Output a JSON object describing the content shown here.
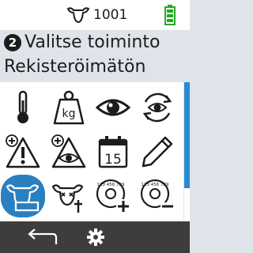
{
  "status_bar": {
    "cow_id": "1001",
    "cow_icon": "cow-head-icon",
    "battery_icon": "battery-full-icon",
    "battery_level": 1.0,
    "battery_color": "#22aa22"
  },
  "header": {
    "step": "2",
    "title": "Valitse toiminto",
    "subtitle": "Rekisteröimätön"
  },
  "actions": [
    {
      "icon": "thermometer-icon",
      "label": ""
    },
    {
      "icon": "weight-kg-icon",
      "label": "kg"
    },
    {
      "icon": "eye-icon",
      "label": ""
    },
    {
      "icon": "eye-repeat-icon",
      "label": ""
    },
    {
      "icon": "warning-plus-icon",
      "label": ""
    },
    {
      "icon": "eye-warning-plus-icon",
      "label": ""
    },
    {
      "icon": "calendar-icon",
      "label": "15"
    },
    {
      "icon": "pencil-icon",
      "label": ""
    },
    {
      "icon": "cow-card-icon",
      "label": ""
    },
    {
      "icon": "cow-death-icon",
      "label": ""
    },
    {
      "icon": "tag-add-icon",
      "label": "123 456 789"
    },
    {
      "icon": "tag-remove-icon",
      "label": "123 456 789"
    }
  ],
  "selected_action_index": 8,
  "scrollbar": {
    "position": 0.0,
    "visible_fraction": 0.76
  },
  "bottom_bar": {
    "back_icon": "back-arrow-icon",
    "settings_icon": "gear-icon"
  },
  "colors": {
    "accent": "#2a7fc0",
    "header_bg": "#dfe4ea",
    "bottom_bar_bg": "#3d3d3d"
  }
}
